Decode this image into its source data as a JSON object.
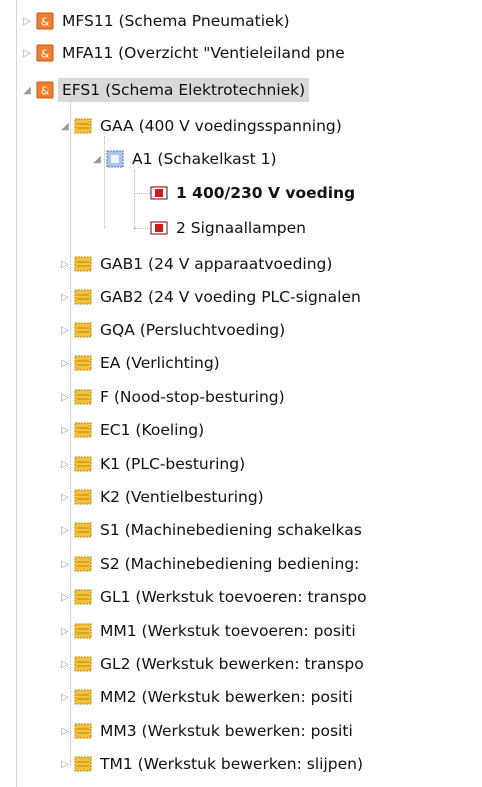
{
  "colors": {
    "selection": "#d9d9d9",
    "schema_icon": "#f07d2e",
    "group_icon": "#f2c13a",
    "cabinet_icon": "#7fa8d4",
    "sheet_icon": "#d11a1a"
  },
  "tree": {
    "items": [
      {
        "label": "MFS11 (Schema Pneumatiek)",
        "icon": "schema-icon",
        "expander": "collapsed"
      },
      {
        "label": "MFA11 (Overzicht \"Ventieleiland pne",
        "icon": "schema-icon",
        "expander": "collapsed"
      },
      {
        "label": "EFS1 (Schema Elektrotechniek)",
        "icon": "schema-icon",
        "expander": "expanded",
        "selected": true
      },
      {
        "label": "GAA (400 V voedingsspanning)",
        "icon": "group-icon",
        "expander": "expanded"
      },
      {
        "label": "A1 (Schakelkast 1)",
        "icon": "cabinet-icon",
        "expander": "expanded"
      },
      {
        "label": "1 400/230 V voeding",
        "icon": "sheet-icon",
        "expander": "none",
        "bold": true
      },
      {
        "label": "2 Signaallampen",
        "icon": "sheet-icon",
        "expander": "none"
      },
      {
        "label": "GAB1 (24 V apparaatvoeding)",
        "icon": "group-icon",
        "expander": "collapsed"
      },
      {
        "label": "GAB2 (24 V voeding PLC-signalen",
        "icon": "group-icon",
        "expander": "collapsed"
      },
      {
        "label": "GQA (Persluchtvoeding)",
        "icon": "group-icon",
        "expander": "collapsed"
      },
      {
        "label": "EA (Verlichting)",
        "icon": "group-icon",
        "expander": "collapsed"
      },
      {
        "label": "F (Nood-stop-besturing)",
        "icon": "group-icon",
        "expander": "collapsed"
      },
      {
        "label": "EC1 (Koeling)",
        "icon": "group-icon",
        "expander": "collapsed"
      },
      {
        "label": "K1 (PLC-besturing)",
        "icon": "group-icon",
        "expander": "collapsed"
      },
      {
        "label": "K2 (Ventielbesturing)",
        "icon": "group-icon",
        "expander": "collapsed"
      },
      {
        "label": "S1 (Machinebediening schakelkas",
        "icon": "group-icon",
        "expander": "collapsed"
      },
      {
        "label": "S2 (Machinebediening bediening:",
        "icon": "group-icon",
        "expander": "collapsed"
      },
      {
        "label": "GL1 (Werkstuk toevoeren: transpo",
        "icon": "group-icon",
        "expander": "collapsed"
      },
      {
        "label": "MM1 (Werkstuk toevoeren: positi",
        "icon": "group-icon",
        "expander": "collapsed"
      },
      {
        "label": "GL2 (Werkstuk bewerken: transpo",
        "icon": "group-icon",
        "expander": "collapsed"
      },
      {
        "label": "MM2 (Werkstuk bewerken: positi",
        "icon": "group-icon",
        "expander": "collapsed"
      },
      {
        "label": "MM3 (Werkstuk bewerken: positi",
        "icon": "group-icon",
        "expander": "collapsed"
      },
      {
        "label": "TM1 (Werkstuk bewerken: slijpen)",
        "icon": "group-icon",
        "expander": "collapsed"
      }
    ]
  }
}
